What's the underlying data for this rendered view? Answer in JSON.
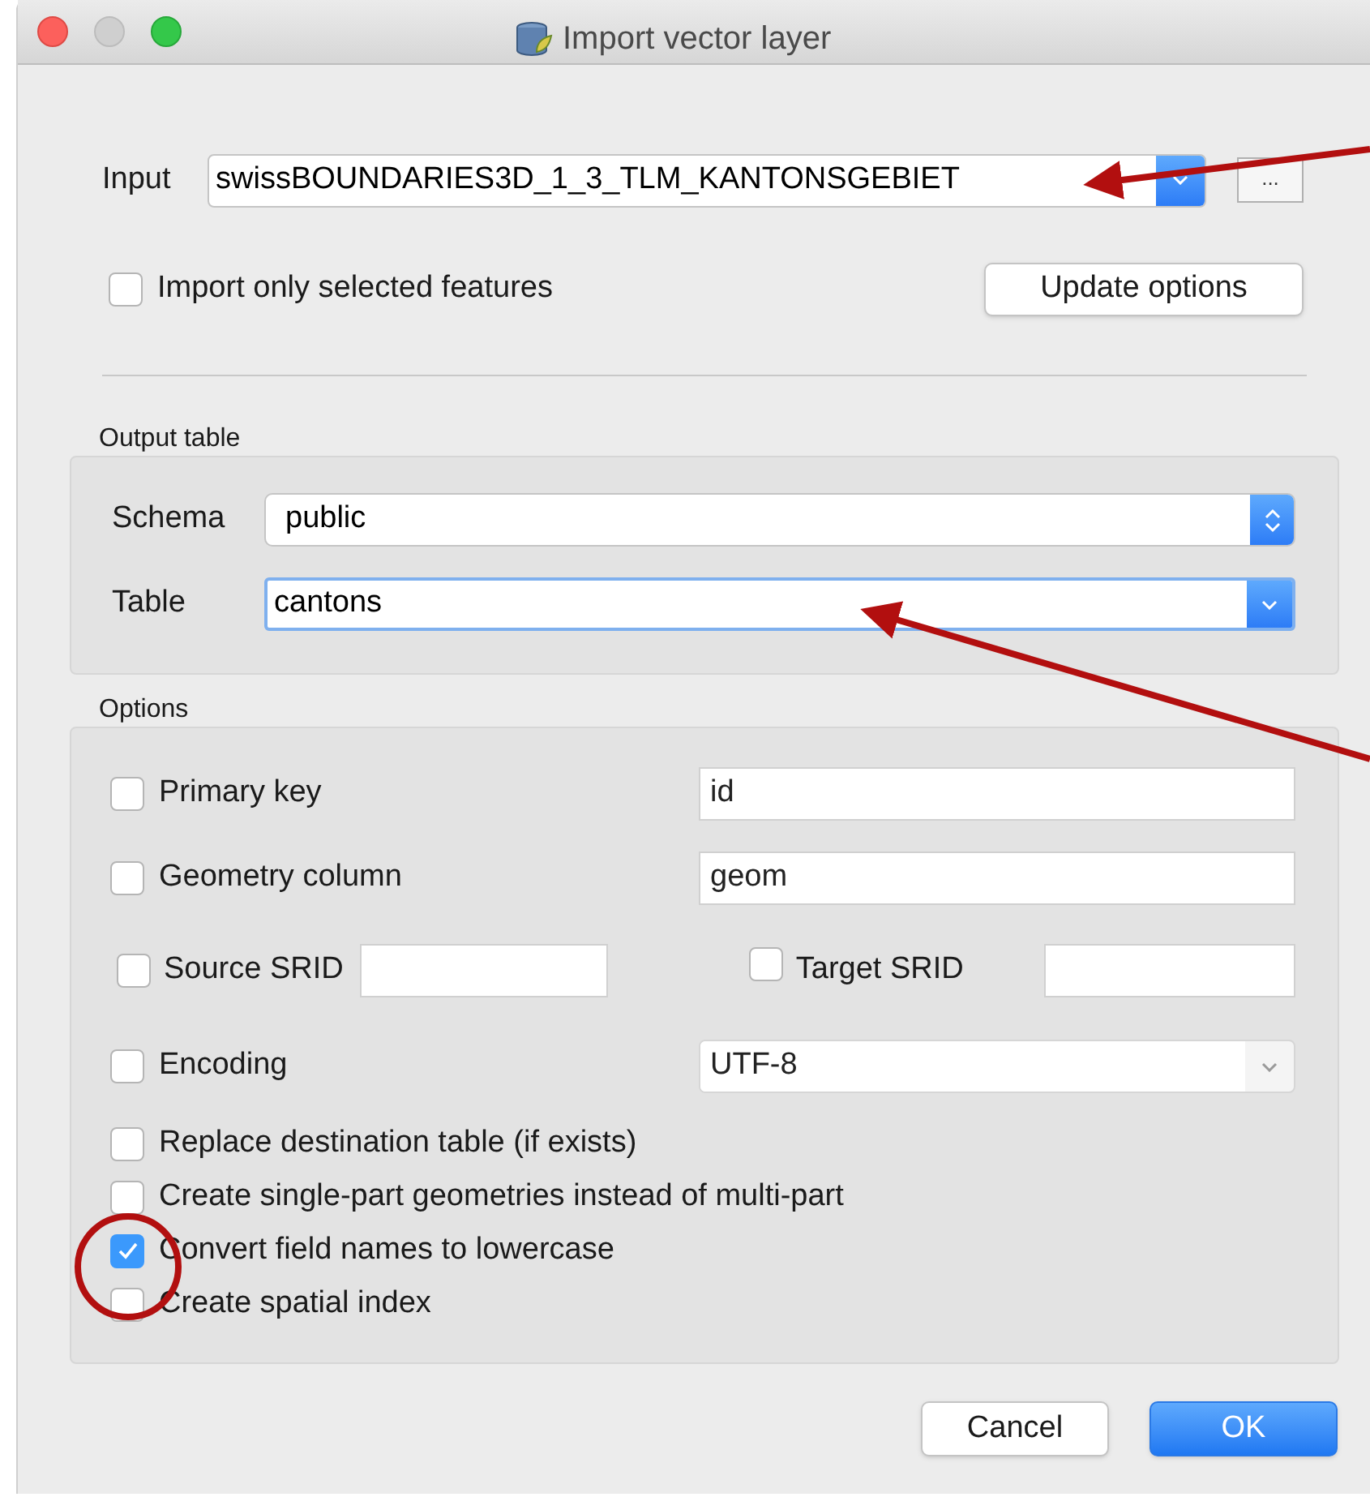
{
  "window": {
    "title": "Import vector layer"
  },
  "input": {
    "label": "Input",
    "value": "swissBOUNDARIES3D_1_3_TLM_KANTONSGEBIET",
    "browse_button": "..."
  },
  "import_selected": {
    "label": "Import only selected features",
    "checked": false
  },
  "update_button": "Update options",
  "output_table": {
    "title": "Output table",
    "schema": {
      "label": "Schema",
      "value": "public"
    },
    "table": {
      "label": "Table",
      "value": "cantons",
      "focused": true
    }
  },
  "options": {
    "title": "Options",
    "primary_key": {
      "label": "Primary key",
      "checked": false,
      "value": "id"
    },
    "geometry_column": {
      "label": "Geometry column",
      "checked": false,
      "value": "geom"
    },
    "source_srid": {
      "label": "Source SRID",
      "checked": false
    },
    "target_srid": {
      "label": "Target SRID",
      "checked": false
    },
    "encoding": {
      "label": "Encoding",
      "checked": false,
      "value": "UTF-8"
    },
    "checks": [
      {
        "label": "Replace destination table (if exists)",
        "checked": false
      },
      {
        "label": "Create single-part geometries instead of multi-part",
        "checked": false
      },
      {
        "label": "Convert field names to lowercase",
        "checked": true
      },
      {
        "label": "Create spatial index",
        "checked": false
      }
    ]
  },
  "buttons": [
    {
      "label": "Cancel",
      "kind": "secondary"
    },
    {
      "label": "OK",
      "kind": "primary"
    }
  ]
}
